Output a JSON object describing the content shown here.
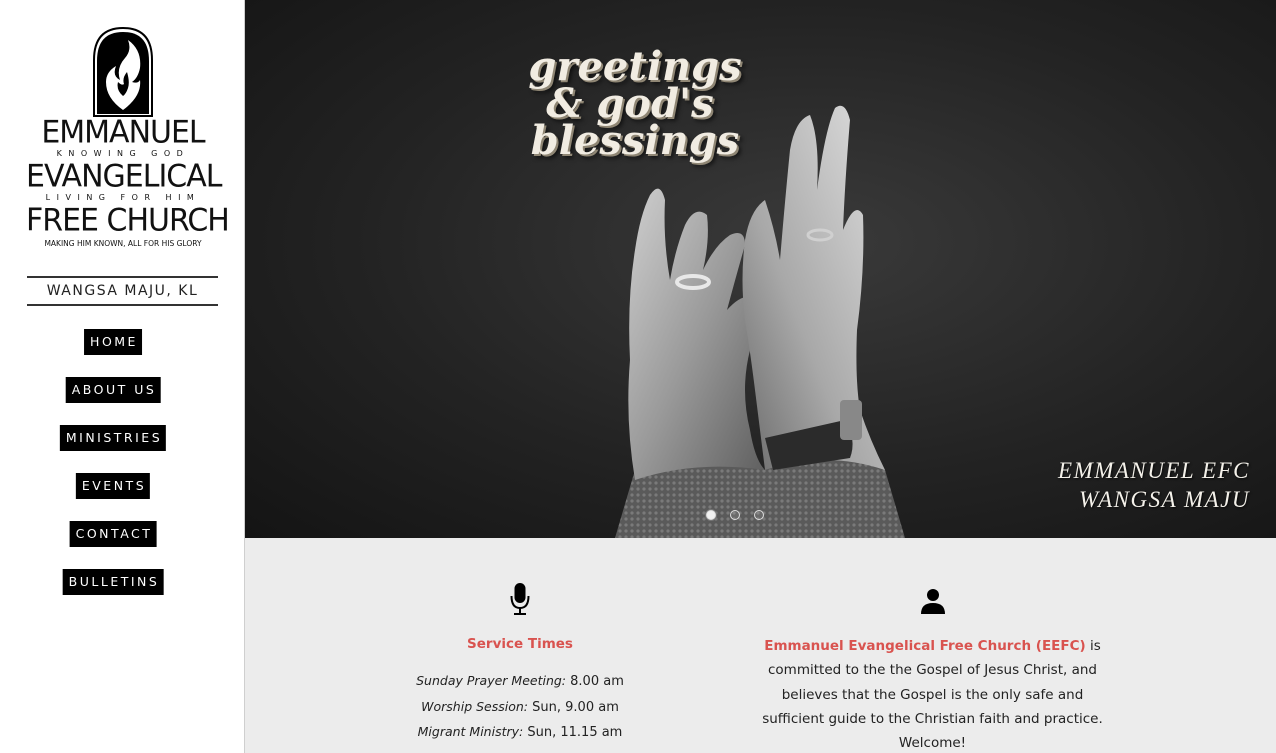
{
  "sidebar": {
    "logo": {
      "line1": "EMMANUEL",
      "line1_sub": "KNOWING GOD",
      "line2": "EVANGELICAL",
      "line2_sub": "LIVING FOR HIM",
      "line3": "FREE CHURCH",
      "tagline": "MAKING HIM KNOWN, ALL FOR HIS GLORY"
    },
    "location": "WANGSA MAJU, KL",
    "nav": [
      {
        "label": "HOME"
      },
      {
        "label": "ABOUT US"
      },
      {
        "label": "MINISTRIES"
      },
      {
        "label": "EVENTS"
      },
      {
        "label": "CONTACT"
      },
      {
        "label": "BULLETINS"
      }
    ]
  },
  "hero": {
    "greeting": [
      "greetings",
      "& god's",
      "blessings"
    ],
    "caption": [
      "EMMANUEL EFC",
      "WANGSA MAJU"
    ],
    "slides_total": 3,
    "active_slide": 1
  },
  "info": {
    "service": {
      "icon": "microphone-icon",
      "heading": "Service Times",
      "items": [
        {
          "label": "Sunday Prayer Meeting:",
          "value": "8.00 am"
        },
        {
          "label": "Worship Session:",
          "value": "Sun, 9.00 am"
        },
        {
          "label": "Migrant Ministry:",
          "value": "Sun, 11.15 am"
        }
      ]
    },
    "about": {
      "icon": "person-icon",
      "highlight": "Emmanuel Evangelical Free Church (EEFC)",
      "after_highlight": "is",
      "lines": [
        "committed to the the Gospel of Jesus Christ, and",
        "believes that the Gospel is the only safe and",
        "sufficient guide to the Christian faith and practice.",
        "Welcome!"
      ]
    }
  },
  "colors": {
    "accent": "#d9534f",
    "nav_bg": "#000000",
    "section_bg": "#ececec"
  }
}
